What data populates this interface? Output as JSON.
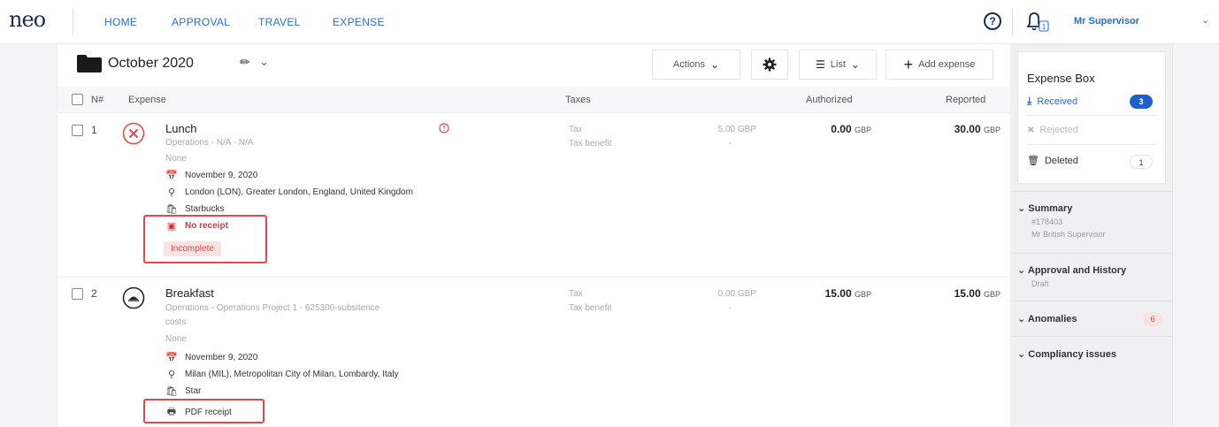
{
  "nav": {
    "logo": "neo",
    "links": [
      "HOME",
      "APPROVAL",
      "TRAVEL",
      "EXPENSE"
    ],
    "help_label": "?",
    "notification_count": "1",
    "user_name": "Mr Supervisor"
  },
  "report": {
    "month": "October 2020",
    "actions_label": "Actions",
    "list_label": "List",
    "add_expense_label": "Add expense"
  },
  "table": {
    "headers": {
      "num": "N#",
      "expense": "Expense",
      "taxes": "Taxes",
      "authorized": "Authorized",
      "reported": "Reported"
    },
    "rows": [
      {
        "num": "1",
        "title": "Lunch",
        "category": "Operations - N/A - N/A",
        "note": "None",
        "date": "November 9, 2020",
        "location": "London (LON), Greater London, England, United Kingdom",
        "merchant": "Starbucks",
        "receipt": "No receipt",
        "status": "Incomplete",
        "tax_label": "Tax",
        "tax_benefit_label": "Tax benefit",
        "tax_value": "5.00 GBP",
        "tax_benefit_value": "-",
        "authorized": "0.00",
        "reported": "30.00",
        "currency": "GBP"
      },
      {
        "num": "2",
        "title": "Breakfast",
        "category_line1": "Operations - Operations Project 1 - 625300-subsitence",
        "category_line2": "costs",
        "note": "None",
        "date": "November 9, 2020",
        "location": "Milan (MIL), Metropolitan City of Milan, Lombardy, Italy",
        "merchant": "Star",
        "receipt": "PDF receipt",
        "tax_label": "Tax",
        "tax_benefit_label": "Tax benefit",
        "tax_value": "0.00 GBP",
        "tax_benefit_value": "-",
        "authorized": "15.00",
        "reported": "15.00",
        "currency": "GBP"
      }
    ]
  },
  "expense_box": {
    "title": "Expense Box",
    "received_label": "Received",
    "received_count": "3",
    "rejected_label": "Rejected",
    "deleted_label": "Deleted",
    "deleted_count": "1"
  },
  "sidebar": {
    "summary_title": "Summary",
    "summary_id": "#178403",
    "summary_name": "Mr British Supervisor",
    "approval_title": "Approval and History",
    "approval_status": "Draft",
    "anomalies_title": "Anomalies",
    "anomalies_count": "6",
    "compliancy_title": "Compliancy issues"
  },
  "colors": {
    "accent": "#2a6ad6",
    "navy": "#1b2b4e",
    "alert_red": "#e14a4a",
    "badge_blue": "#1f5fce"
  }
}
